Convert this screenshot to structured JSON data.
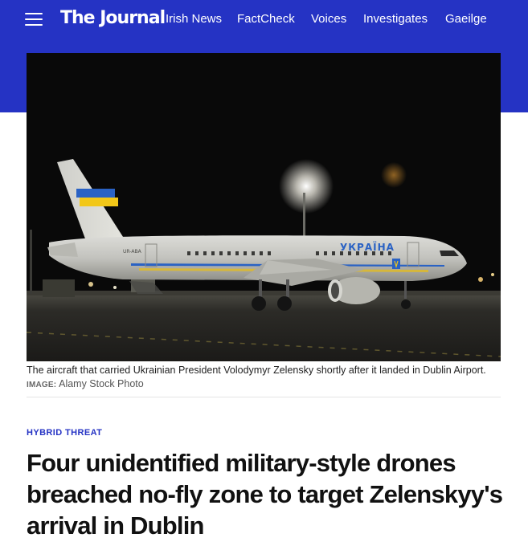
{
  "brand": {
    "logo_text": "The Journal",
    "accent_color": "#2533c4"
  },
  "nav": {
    "menu_icon": "hamburger-menu-icon",
    "links": [
      "Irish News",
      "FactCheck",
      "Voices",
      "Investigates",
      "Gaeilge"
    ]
  },
  "photo": {
    "fuselage_text": "УКРАЇНА",
    "registration": "UR-ABA"
  },
  "caption": {
    "text": "The aircraft that carried Ukrainian President Volodymyr Zelensky shortly after it landed in Dublin Airport.",
    "credit_label": "IMAGE:",
    "credit": "Alamy Stock Photo"
  },
  "article": {
    "kicker": "HYBRID THREAT",
    "headline": "Four unidentified military-style drones breached no-fly zone to target Zelenskyy's arrival in Dublin"
  }
}
